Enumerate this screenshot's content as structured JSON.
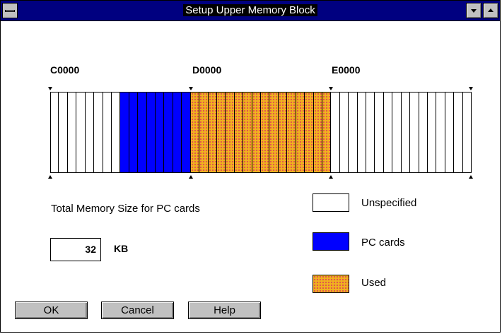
{
  "window": {
    "title": "Setup Upper Memory Block"
  },
  "memory_map": {
    "addresses": [
      "C0000",
      "D0000",
      "E0000"
    ],
    "blocks": [
      "unspecified",
      "unspecified",
      "unspecified",
      "unspecified",
      "unspecified",
      "unspecified",
      "unspecified",
      "unspecified",
      "pc_cards",
      "pc_cards",
      "pc_cards",
      "pc_cards",
      "pc_cards",
      "pc_cards",
      "pc_cards",
      "pc_cards",
      "used",
      "used",
      "used",
      "used",
      "used",
      "used",
      "used",
      "used",
      "used",
      "used",
      "used",
      "used",
      "used",
      "used",
      "used",
      "used",
      "unspecified",
      "unspecified",
      "unspecified",
      "unspecified",
      "unspecified",
      "unspecified",
      "unspecified",
      "unspecified",
      "unspecified",
      "unspecified",
      "unspecified",
      "unspecified",
      "unspecified",
      "unspecified",
      "unspecified",
      "unspecified"
    ]
  },
  "total_memory": {
    "label": "Total Memory Size for PC cards",
    "value": "32",
    "unit": "KB"
  },
  "legend": {
    "unspecified": "Unspecified",
    "pc_cards": "PC cards",
    "used": "Used"
  },
  "buttons": {
    "ok": "OK",
    "cancel": "Cancel",
    "help": "Help"
  },
  "colors": {
    "title_bar": "#000080",
    "pc_cards": "#0000ff",
    "used_base": "#f0b020",
    "used_dots": "#e05050"
  }
}
